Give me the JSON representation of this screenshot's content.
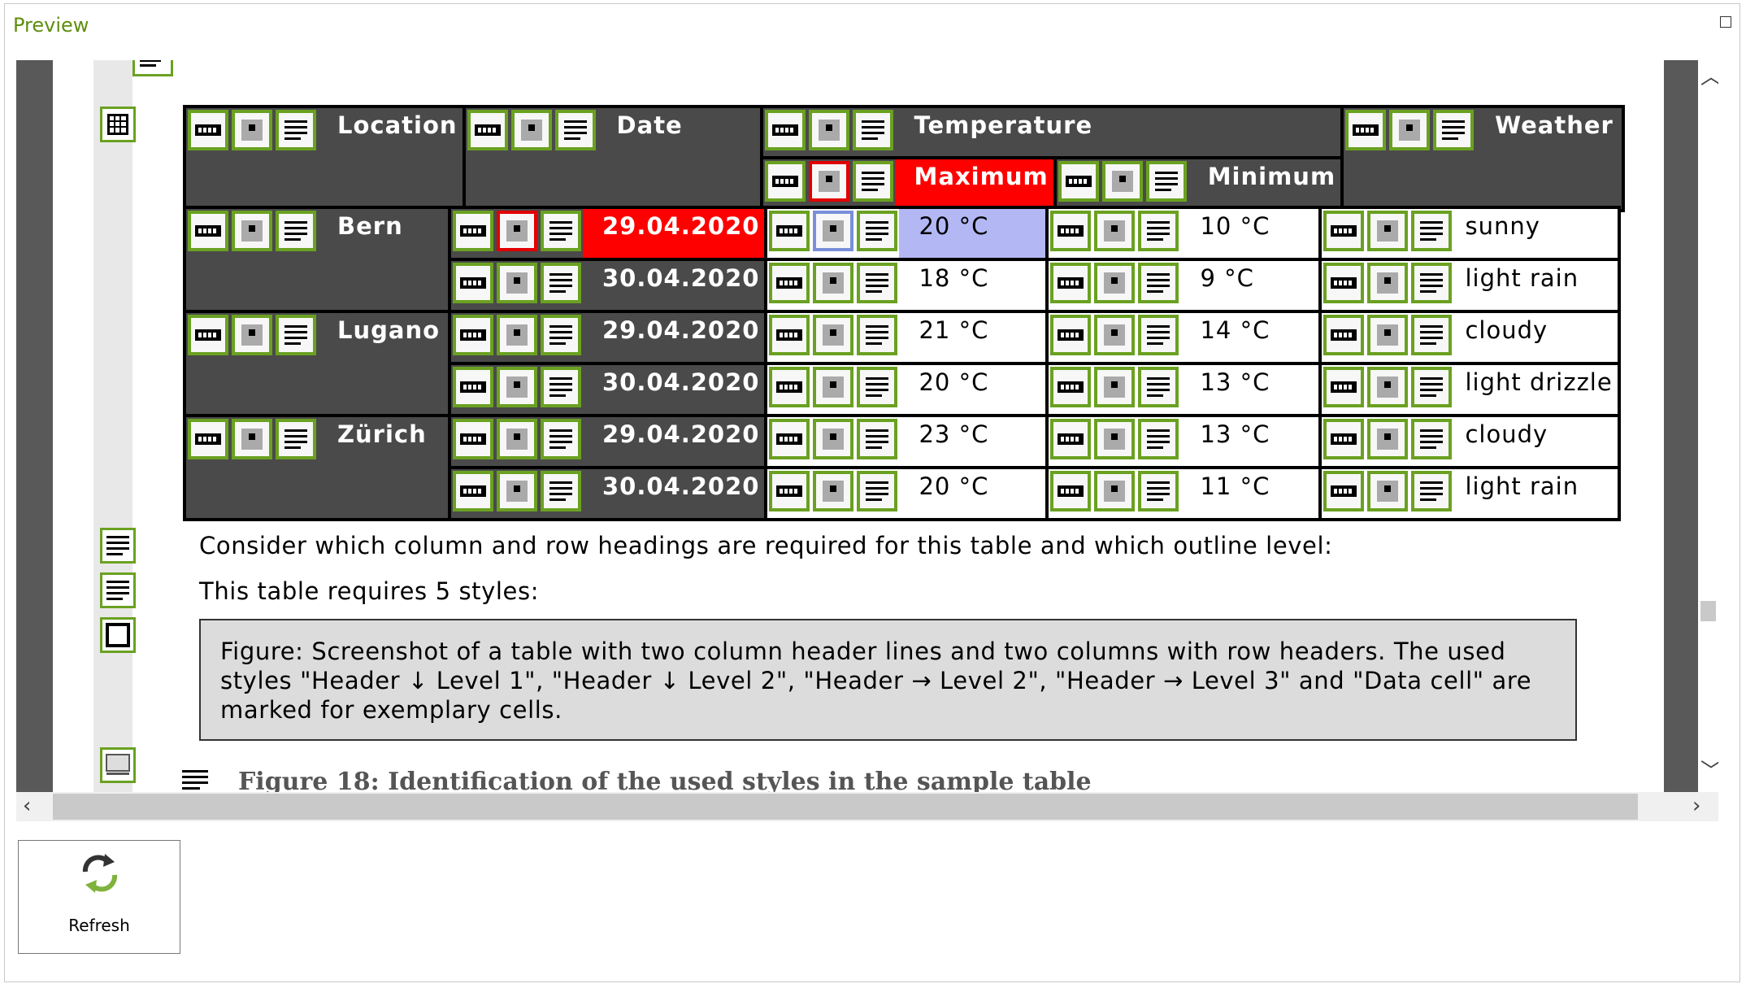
{
  "window": {
    "title": "Preview"
  },
  "table": {
    "header1": {
      "location": "Location",
      "date": "Date",
      "temperature": "Temperature",
      "weather": "Weather"
    },
    "header2": {
      "maximum": "Maximum",
      "minimum": "Minimum"
    },
    "rows": [
      {
        "location": "Bern",
        "date": "29.04.2020",
        "max": "20 °C",
        "min": "10 °C",
        "weather": "sunny"
      },
      {
        "location": "",
        "date": "30.04.2020",
        "max": "18 °C",
        "min": "9 °C",
        "weather": "light rain"
      },
      {
        "location": "Lugano",
        "date": "29.04.2020",
        "max": "21 °C",
        "min": "14 °C",
        "weather": "cloudy"
      },
      {
        "location": "",
        "date": "30.04.2020",
        "max": "20 °C",
        "min": "13 °C",
        "weather": "light drizzle"
      },
      {
        "location": "Zürich",
        "date": "29.04.2020",
        "max": "23 °C",
        "min": "13 °C",
        "weather": "cloudy"
      },
      {
        "location": "",
        "date": "30.04.2020",
        "max": "20 °C",
        "min": "11 °C",
        "weather": "light rain"
      }
    ]
  },
  "paragraphs": {
    "p1": "Consider which column and row headings are required for this table and which outline level:",
    "p2": "This table requires 5 styles:"
  },
  "figure": {
    "alt": "Figure: Screenshot of a table with two column header lines and two columns with row headers. The used styles \"Header ↓ Level 1\", \"Header ↓ Level 2\", \"Header → Level 2\", \"Header → Level 3\" and \"Data cell\" are marked for exemplary cells.",
    "caption": "Figure 18: Identification of the used styles in the sample table"
  },
  "buttons": {
    "refresh": "Refresh"
  },
  "colors": {
    "accent_green": "#6aa121",
    "header_bg": "#4a4a4a",
    "highlight_red": "#ff0000",
    "highlight_blue": "#b3b8f5",
    "title_green": "#5e8e0f"
  },
  "icons": [
    "table-icon",
    "cell-icon",
    "paragraph-icon",
    "frame-icon",
    "refresh-icon",
    "chevron-up-icon",
    "chevron-down-icon",
    "chevron-left-icon",
    "chevron-right-icon"
  ]
}
